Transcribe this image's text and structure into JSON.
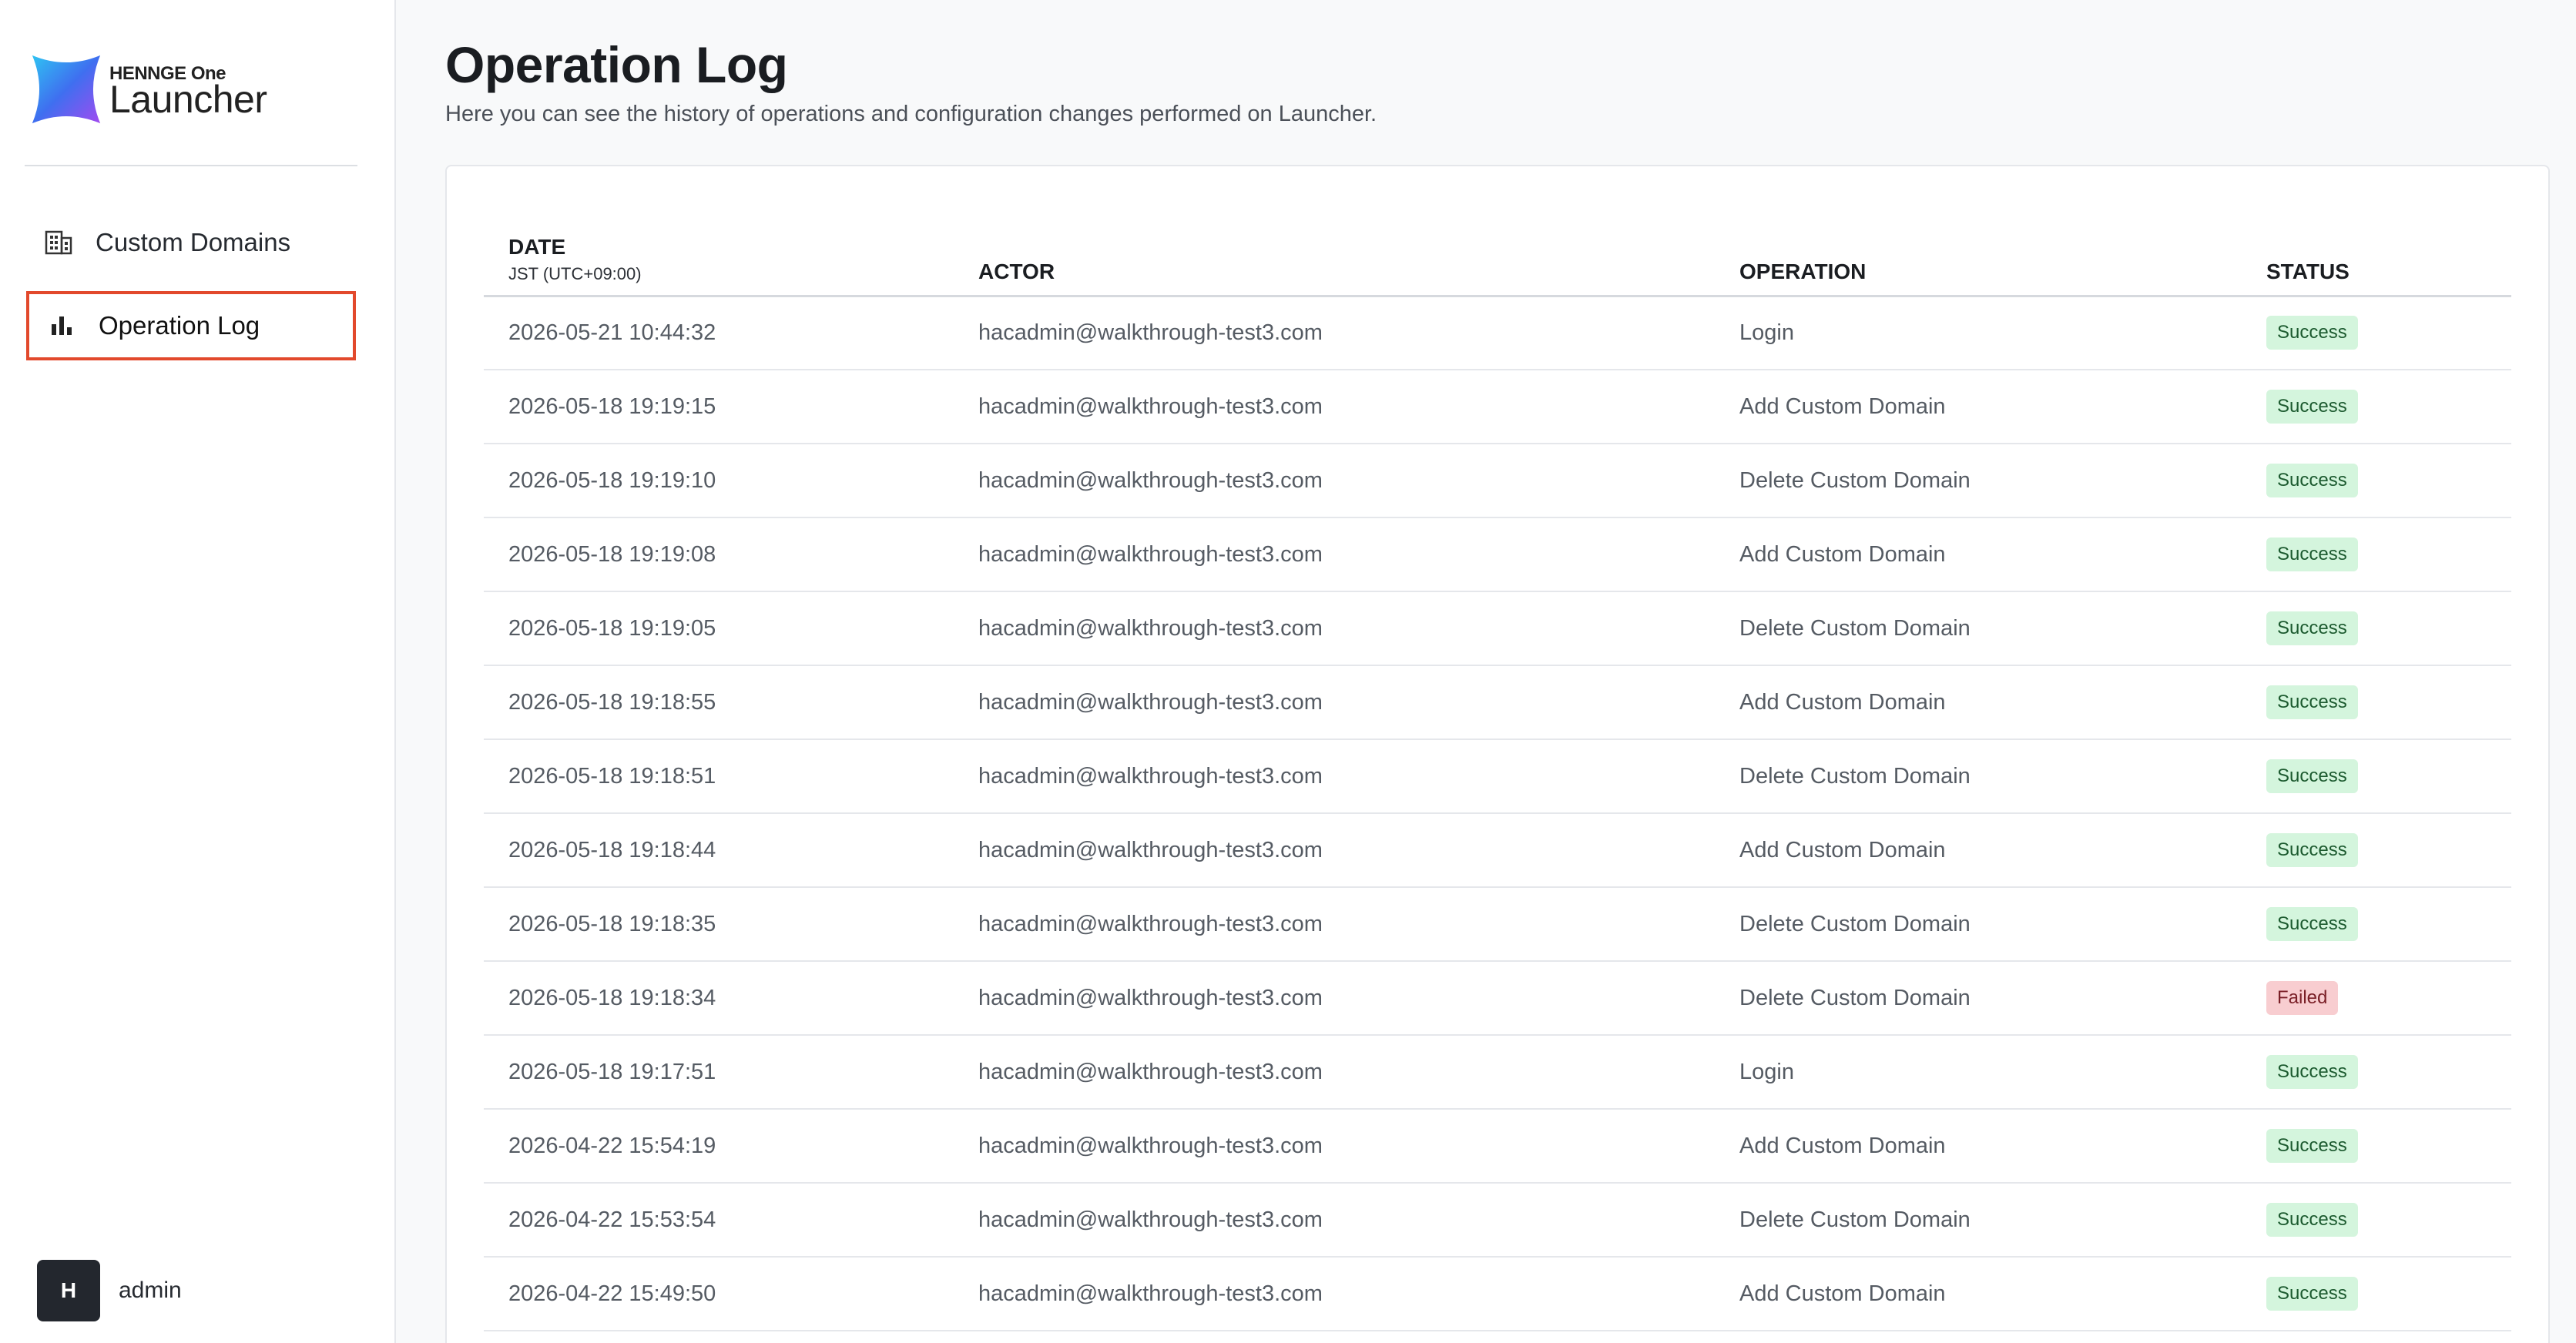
{
  "brand": {
    "sub": "HENNGE One",
    "name": "Launcher"
  },
  "sidebar": {
    "items": [
      {
        "label": "Custom Domains",
        "icon": "building-icon",
        "active": false
      },
      {
        "label": "Operation Log",
        "icon": "bar-chart-icon",
        "active": true
      }
    ],
    "user": {
      "initial": "H",
      "name": "admin"
    }
  },
  "page": {
    "title": "Operation Log",
    "subtitle": "Here you can see the history of operations and configuration changes performed on Launcher."
  },
  "table": {
    "headers": {
      "date": "DATE",
      "date_tz": "JST (UTC+09:00)",
      "actor": "ACTOR",
      "operation": "OPERATION",
      "status": "STATUS"
    },
    "rows": [
      {
        "date": "2026-05-21 10:44:32",
        "actor": "hacadmin@walkthrough-test3.com",
        "operation": "Login",
        "status": "Success"
      },
      {
        "date": "2026-05-18 19:19:15",
        "actor": "hacadmin@walkthrough-test3.com",
        "operation": "Add Custom Domain",
        "status": "Success"
      },
      {
        "date": "2026-05-18 19:19:10",
        "actor": "hacadmin@walkthrough-test3.com",
        "operation": "Delete Custom Domain",
        "status": "Success"
      },
      {
        "date": "2026-05-18 19:19:08",
        "actor": "hacadmin@walkthrough-test3.com",
        "operation": "Add Custom Domain",
        "status": "Success"
      },
      {
        "date": "2026-05-18 19:19:05",
        "actor": "hacadmin@walkthrough-test3.com",
        "operation": "Delete Custom Domain",
        "status": "Success"
      },
      {
        "date": "2026-05-18 19:18:55",
        "actor": "hacadmin@walkthrough-test3.com",
        "operation": "Add Custom Domain",
        "status": "Success"
      },
      {
        "date": "2026-05-18 19:18:51",
        "actor": "hacadmin@walkthrough-test3.com",
        "operation": "Delete Custom Domain",
        "status": "Success"
      },
      {
        "date": "2026-05-18 19:18:44",
        "actor": "hacadmin@walkthrough-test3.com",
        "operation": "Add Custom Domain",
        "status": "Success"
      },
      {
        "date": "2026-05-18 19:18:35",
        "actor": "hacadmin@walkthrough-test3.com",
        "operation": "Delete Custom Domain",
        "status": "Success"
      },
      {
        "date": "2026-05-18 19:18:34",
        "actor": "hacadmin@walkthrough-test3.com",
        "operation": "Delete Custom Domain",
        "status": "Failed"
      },
      {
        "date": "2026-05-18 19:17:51",
        "actor": "hacadmin@walkthrough-test3.com",
        "operation": "Login",
        "status": "Success"
      },
      {
        "date": "2026-04-22 15:54:19",
        "actor": "hacadmin@walkthrough-test3.com",
        "operation": "Add Custom Domain",
        "status": "Success"
      },
      {
        "date": "2026-04-22 15:53:54",
        "actor": "hacadmin@walkthrough-test3.com",
        "operation": "Delete Custom Domain",
        "status": "Success"
      },
      {
        "date": "2026-04-22 15:49:50",
        "actor": "hacadmin@walkthrough-test3.com",
        "operation": "Add Custom Domain",
        "status": "Success"
      }
    ]
  },
  "colors": {
    "active_outline": "#e2492c",
    "success_bg": "#d4f5dd",
    "failed_bg": "#f8cdd0"
  }
}
